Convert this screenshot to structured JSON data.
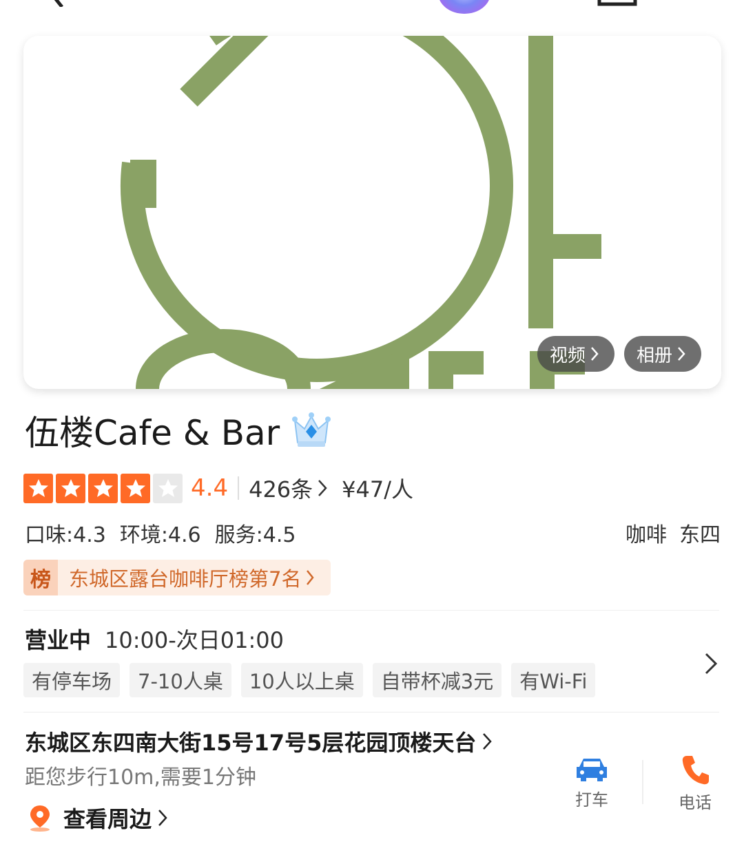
{
  "header": {
    "back_icon": "back-arrow-icon",
    "assistant_icon": "ai-orb-icon",
    "favorite_icon": "star-icon",
    "share_icon": "share-icon"
  },
  "hero": {
    "video_label": "视频",
    "album_label": "相册",
    "brand_color": "#8aa265"
  },
  "shop": {
    "name": "伍楼Cafe & Bar",
    "rating": "4.4",
    "rating_stars": 4,
    "review_count": "426条",
    "avg_price": "¥47/人",
    "subscores": [
      "口味:4.3",
      "环境:4.6",
      "服务:4.5"
    ],
    "category": "咖啡",
    "area": "东四",
    "rank_icon_text": "榜",
    "rank_text": "东城区露台咖啡厅榜第7名"
  },
  "hours": {
    "status": "营业中",
    "time": "10:00-次日01:00"
  },
  "tags": [
    "有停车场",
    "7-10人桌",
    "10人以上桌",
    "自带杯减3元",
    "有Wi-Fi"
  ],
  "location": {
    "address": "东城区东四南大街15号17号5层花园顶楼天台",
    "distance": "距您步行10m,需要1分钟",
    "nearby_label": "查看周边"
  },
  "actions": {
    "taxi_label": "打车",
    "phone_label": "电话"
  },
  "colors": {
    "accent": "#ff6a26",
    "taxi_blue": "#2f7fe0",
    "phone_orange": "#ff6a26"
  }
}
